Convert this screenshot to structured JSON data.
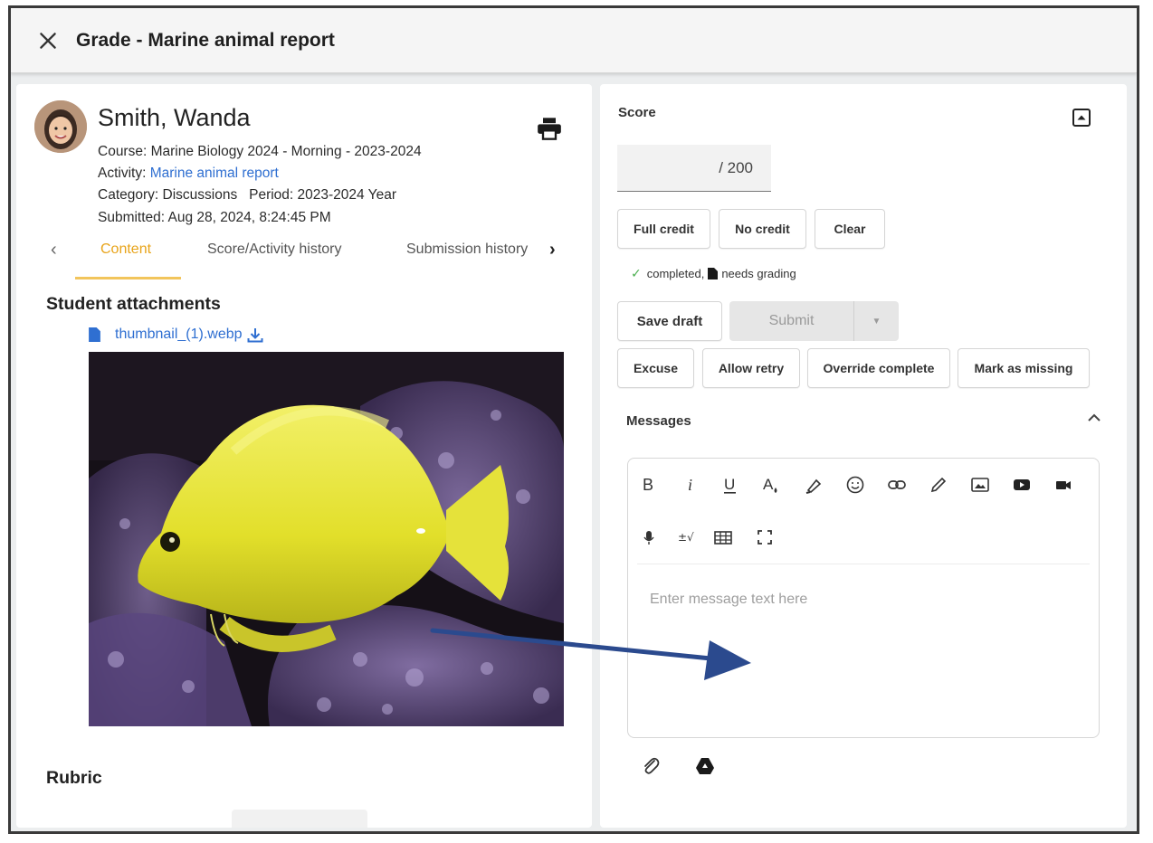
{
  "window": {
    "title": "Grade - Marine animal report"
  },
  "student": {
    "name": "Smith, Wanda",
    "course": "Course: Marine Biology 2024 - Morning - 2023-2024",
    "activity_label": "Activity:",
    "activity_link": "Marine animal report",
    "category": "Category: Discussions   Period: 2023-2024 Year",
    "submitted": "Submitted: Aug 28, 2024, 8:24:45 PM"
  },
  "tabs": {
    "items": [
      "Content",
      "Score/Activity history",
      "Submission history"
    ],
    "active": "Content"
  },
  "content": {
    "attachments_title": "Student attachments",
    "attachment_file": "thumbnail_(1).webp",
    "rubric_title": "Rubric"
  },
  "score": {
    "label": "Score",
    "value": "",
    "max": "/ 200",
    "full_credit": "Full credit",
    "no_credit": "No credit",
    "clear": "Clear",
    "status_completed": "completed,",
    "status_needs_grading": "needs grading"
  },
  "actions": {
    "save_draft": "Save draft",
    "submit": "Submit",
    "excuse": "Excuse",
    "allow_retry": "Allow retry",
    "override_complete": "Override complete",
    "mark_missing": "Mark as missing"
  },
  "messages": {
    "label": "Messages",
    "placeholder": "Enter message text here"
  },
  "colors": {
    "accent_tab": "#e8a41a",
    "link": "#2f6fd1",
    "arrow": "#2b4a8e",
    "check": "#4caf50"
  }
}
